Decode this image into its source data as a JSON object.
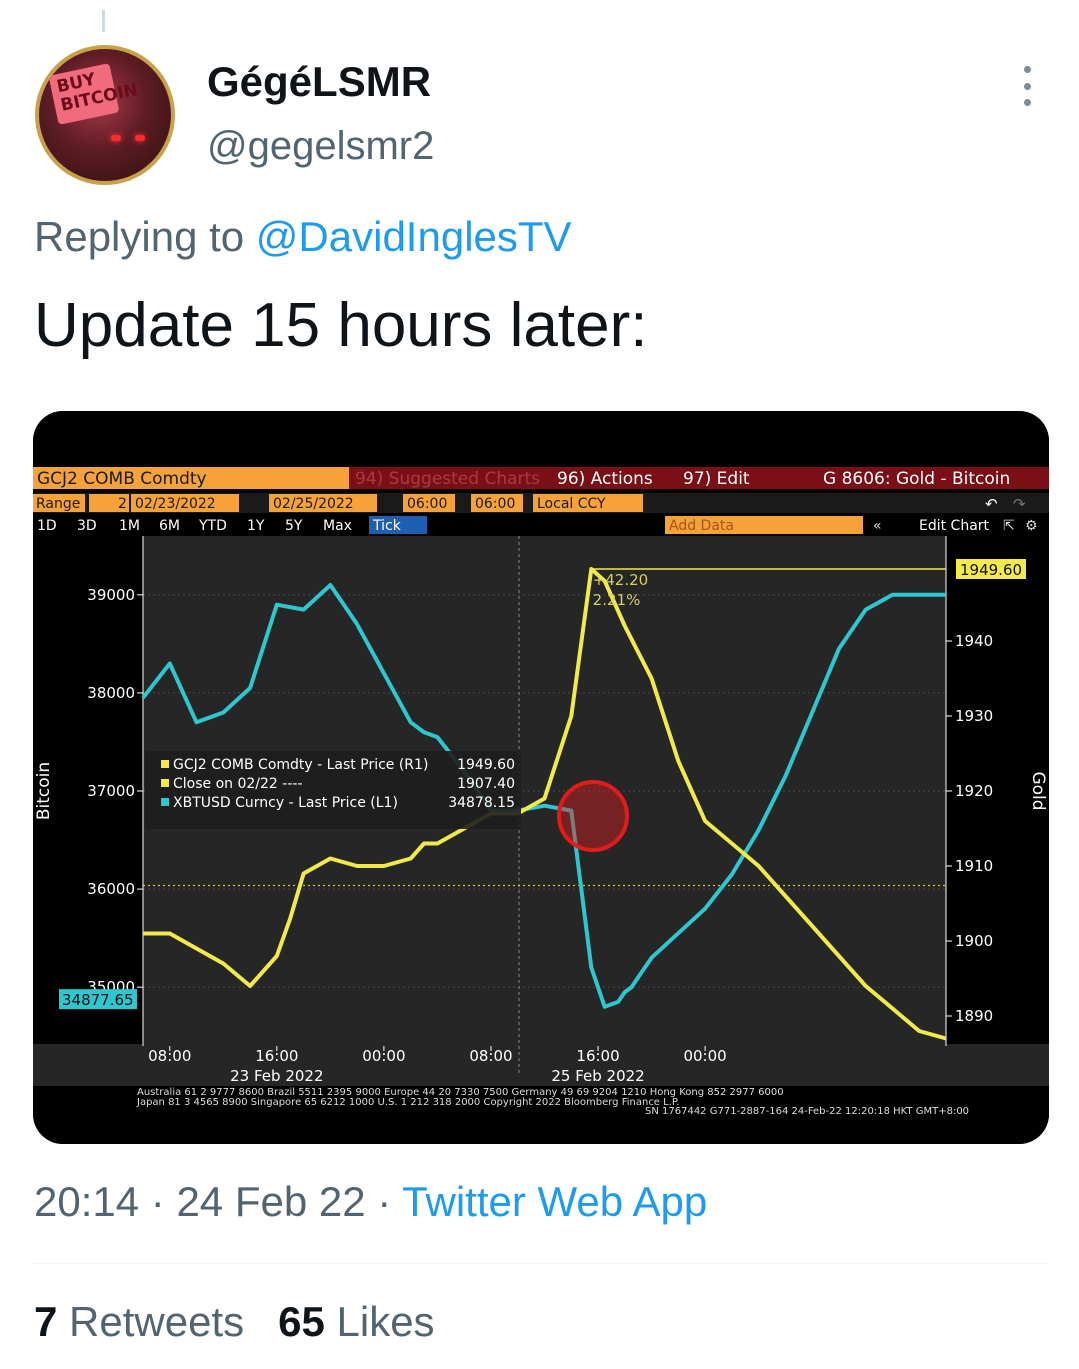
{
  "tweet": {
    "display_name": "GégéLSMR",
    "handle": "@gegelsmr2",
    "avatar_text": "BUY BITCOIN",
    "reply_prefix": "Replying to ",
    "reply_to": "@DavidInglesTV",
    "text": "Update 15 hours later:",
    "time": "20:14",
    "date": "24 Feb 22",
    "separator": " · ",
    "app": "Twitter Web App",
    "retweets_count": "7",
    "retweets_label": "Retweets",
    "likes_count": "65",
    "likes_label": "Likes"
  },
  "terminal": {
    "security": "GCJ2 COMB Comdty",
    "suggested": "94) Suggested Charts",
    "actions": "96) Actions",
    "edit": "97) Edit",
    "chart_title": "G 8606: Gold - Bitcoin",
    "range_label": "Range",
    "range_num": "2",
    "start_date": "02/23/2022",
    "end_date": "02/25/2022",
    "start_time": "06:00",
    "end_time": "06:00",
    "currency": "Local CCY",
    "periods": [
      "1D",
      "3D",
      "1M",
      "6M",
      "YTD",
      "1Y",
      "5Y",
      "Max"
    ],
    "tick": "Tick",
    "add_data": "Add Data",
    "edit_chart": "Edit Chart",
    "footer_line1": "Australia 61 2 9777 8600 Brazil 5511 2395 9000 Europe 44 20 7330 7500 Germany 49 69 9204 1210 Hong Kong 852 2977 6000",
    "footer_line2": "Japan 81 3 4565 8900        Singapore 65 6212 1000        U.S. 1 212 318 2000        Copyright 2022 Bloomberg Finance L.P.",
    "footer_line3": "SN 1767442 G771-2887-164 24-Feb-22 12:20:18 HKT  GMT+8:00"
  },
  "chart_data": {
    "type": "line",
    "y_left_label": "Bitcoin",
    "y_right_label": "Gold",
    "y_left_ticks": [
      35000,
      36000,
      37000,
      38000,
      39000
    ],
    "y_right_ticks": [
      1890,
      1900,
      1910,
      1920,
      1930,
      1940
    ],
    "y_left_range": [
      34400,
      39600
    ],
    "y_right_range": [
      1886,
      1954
    ],
    "x_ticks": [
      "08:00",
      "16:00",
      "00:00",
      "08:00",
      "16:00",
      "00:00"
    ],
    "x_dates": [
      "23 Feb 2022",
      "25 Feb 2022"
    ],
    "last_price_gold_label": "1949.60",
    "last_price_btc_label": "34877.65",
    "peak_labels": [
      "+42.20",
      "2.21%"
    ],
    "close_reference": 1907.4,
    "legend": [
      {
        "marker": "yellow",
        "text": "GCJ2 COMB Comdty - Last Price (R1)",
        "value": "1949.60"
      },
      {
        "marker": "yellow",
        "text": "Close on 02/22 ----",
        "value": "1907.40"
      },
      {
        "marker": "cyan",
        "text": "XBTUSD Curncy - Last Price (L1)",
        "value": "34878.15"
      }
    ],
    "series": [
      {
        "name": "XBTUSD Curncy - Last Price (L1)",
        "axis": "left",
        "color": "#2ec7cf",
        "x": [
          0,
          2,
          4,
          6,
          8,
          10,
          12,
          14,
          16,
          18,
          20,
          21,
          22,
          24,
          26,
          28,
          30,
          32,
          33.5,
          34.5,
          35.5,
          36,
          36.5,
          37,
          38,
          40,
          42,
          44,
          46,
          48,
          50,
          52,
          54,
          56,
          58,
          60
        ],
        "values": [
          37950,
          38300,
          37700,
          37800,
          38050,
          38900,
          38850,
          39100,
          38700,
          38200,
          37700,
          37600,
          37550,
          37200,
          36800,
          36800,
          36850,
          36800,
          35200,
          34800,
          34850,
          34950,
          35000,
          35100,
          35300,
          35550,
          35800,
          36150,
          36600,
          37150,
          37800,
          38450,
          38850,
          39000,
          39000,
          39000
        ]
      },
      {
        "name": "GCJ2 COMB Comdty - Last Price (R1)",
        "axis": "right",
        "color": "#f2e94a",
        "x": [
          0,
          2,
          4,
          6,
          8,
          10,
          11,
          12,
          14,
          16,
          18,
          20,
          21,
          22,
          24,
          26,
          28,
          30,
          32,
          33.5,
          34.5,
          36,
          38,
          40,
          42,
          44,
          46,
          48,
          50,
          52,
          54,
          56,
          58,
          60
        ],
        "values": [
          1901,
          1901,
          1899,
          1897,
          1894,
          1898,
          1903,
          1909,
          1911,
          1910,
          1910,
          1911,
          1913,
          1913,
          1915,
          1917,
          1917,
          1919,
          1930,
          1949.6,
          1948,
          1942,
          1935,
          1924,
          1916,
          1913,
          1910,
          1906,
          1902,
          1898,
          1894,
          1891,
          1888,
          1887
        ]
      }
    ]
  }
}
